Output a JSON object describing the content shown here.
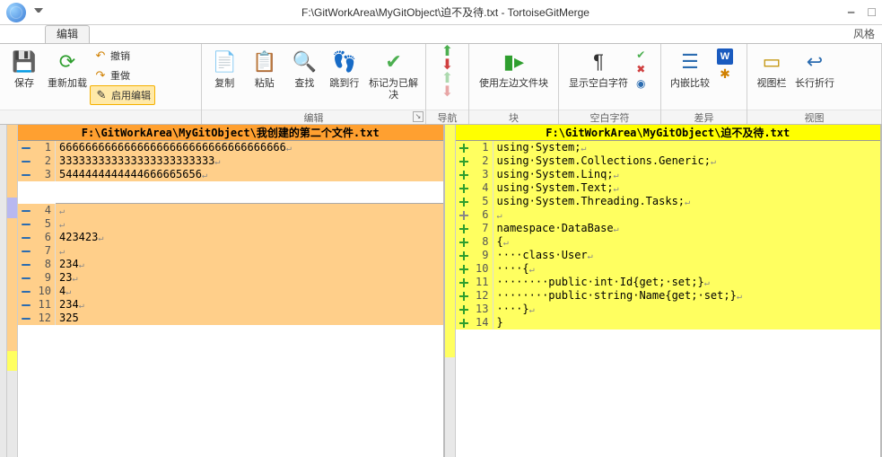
{
  "title": "F:\\GitWorkArea\\MyGitObject\\迫不及待.txt - TortoiseGitMerge",
  "tab_edit": "编辑",
  "link_style": "风格",
  "ribbon": {
    "save": "保存",
    "reload": "重新加载",
    "undo": "撤销",
    "redo": "重做",
    "enable_edit": "启用编辑",
    "copy": "复制",
    "paste": "粘贴",
    "find": "查找",
    "goto": "跳到行",
    "mark_resolved": "标记为已解决",
    "group_edit": "编辑",
    "group_nav": "导航",
    "use_left_block": "使用左边文件块",
    "group_block": "块",
    "show_whitespace": "显示空白字符",
    "group_whitespace": "空白字符",
    "inline_diff": "内嵌比较",
    "group_diff": "差异",
    "view_bar": "视图栏",
    "wrap": "长行折行",
    "group_view": "视图"
  },
  "left": {
    "header": "F:\\GitWorkArea\\MyGitObject\\我创建的第二个文件.txt",
    "lines": [
      {
        "n": 1,
        "t": "66666666666666666666666666666666666",
        "m": "minus",
        "cls": "removed",
        "eol": true
      },
      {
        "n": 2,
        "t": "333333333333333333333333",
        "m": "minus",
        "cls": "removed",
        "eol": true
      },
      {
        "n": 3,
        "t": "5444444444444666665656",
        "m": "minus",
        "cls": "removed",
        "eol": true
      }
    ],
    "lines2": [
      {
        "n": 4,
        "t": "",
        "m": "minus",
        "cls": "removed",
        "eol": true
      },
      {
        "n": 5,
        "t": "",
        "m": "minus",
        "cls": "removed",
        "eol": true
      },
      {
        "n": 6,
        "t": "423423",
        "m": "minus",
        "cls": "removed",
        "eol": true
      },
      {
        "n": 7,
        "t": "",
        "m": "minus",
        "cls": "removed",
        "eol": true
      },
      {
        "n": 8,
        "t": "234",
        "m": "minus",
        "cls": "removed",
        "eol": true
      },
      {
        "n": 9,
        "t": "23",
        "m": "minus",
        "cls": "removed",
        "eol": true
      },
      {
        "n": 10,
        "t": "4",
        "m": "minus",
        "cls": "removed",
        "eol": true
      },
      {
        "n": 11,
        "t": "234",
        "m": "minus",
        "cls": "removed",
        "eol": true
      },
      {
        "n": 12,
        "t": "325",
        "m": "minus",
        "cls": "removed"
      }
    ]
  },
  "right": {
    "header": "F:\\GitWorkArea\\MyGitObject\\迫不及待.txt",
    "lines": [
      {
        "n": 1,
        "t": "using·System;",
        "m": "plus",
        "cls": "added",
        "eol": true
      },
      {
        "n": 2,
        "t": "using·System.Collections.Generic;",
        "m": "plus",
        "cls": "added",
        "eol": true
      },
      {
        "n": 3,
        "t": "using·System.Linq;",
        "m": "plus",
        "cls": "added",
        "eol": true
      },
      {
        "n": 4,
        "t": "using·System.Text;",
        "m": "plus",
        "cls": "added",
        "eol": true
      },
      {
        "n": 5,
        "t": "using·System.Threading.Tasks;",
        "m": "plus",
        "cls": "added",
        "eol": true
      },
      {
        "n": 6,
        "t": "",
        "m": "plus",
        "cls": "added gray",
        "eol": true
      },
      {
        "n": 7,
        "t": "namespace·DataBase",
        "m": "plus",
        "cls": "added",
        "eol": true
      },
      {
        "n": 8,
        "t": "{",
        "m": "plus",
        "cls": "added",
        "eol": true
      },
      {
        "n": 9,
        "t": "····class·User",
        "m": "plus",
        "cls": "added",
        "eol": true
      },
      {
        "n": 10,
        "t": "····{",
        "m": "plus",
        "cls": "added",
        "eol": true
      },
      {
        "n": 11,
        "t": "········public·int·Id{get;·set;}",
        "m": "plus",
        "cls": "added",
        "eol": true
      },
      {
        "n": 12,
        "t": "········public·string·Name{get;·set;}",
        "m": "plus",
        "cls": "added",
        "eol": true
      },
      {
        "n": 13,
        "t": "····}",
        "m": "plus",
        "cls": "added",
        "eol": true
      },
      {
        "n": 14,
        "t": "}",
        "m": "plus",
        "cls": "added"
      }
    ]
  }
}
